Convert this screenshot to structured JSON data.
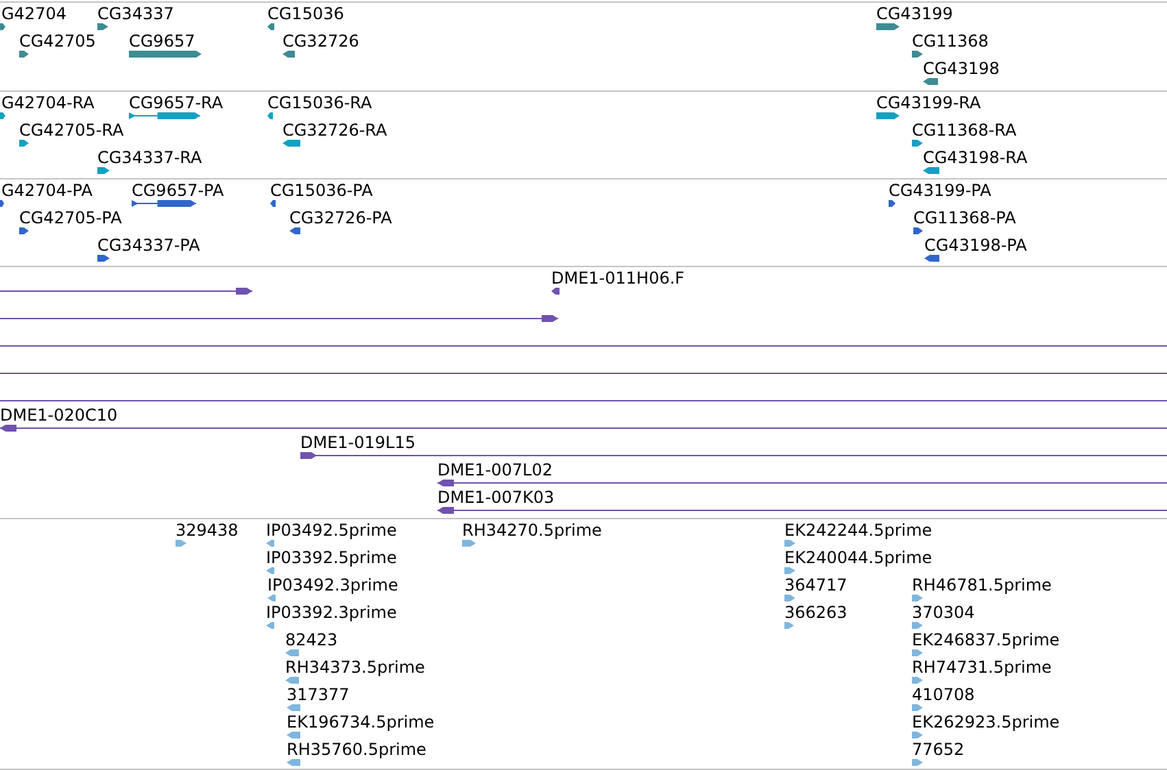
{
  "tracks": [
    {
      "kind": "gene",
      "color": "#3d8c94",
      "features": [
        {
          "label": "G42704",
          "reverse": false
        },
        {
          "label": "CG34337",
          "reverse": false
        },
        {
          "label": "CG15036",
          "reverse": true
        },
        {
          "label": "CG43199",
          "reverse": false
        },
        {
          "label": "CG42705",
          "reverse": false
        },
        {
          "label": "CG9657",
          "reverse": false
        },
        {
          "label": "CG32726",
          "reverse": true
        },
        {
          "label": "CG11368",
          "reverse": false
        },
        {
          "label": "CG43198",
          "reverse": true
        }
      ]
    },
    {
      "kind": "transcript",
      "color": "#13a1c1",
      "features": [
        {
          "label": "G42704-RA",
          "reverse": false
        },
        {
          "label": "CG9657-RA",
          "reverse": false
        },
        {
          "label": "CG15036-RA",
          "reverse": true
        },
        {
          "label": "CG43199-RA",
          "reverse": false
        },
        {
          "label": "CG42705-RA",
          "reverse": false
        },
        {
          "label": "CG32726-RA",
          "reverse": true
        },
        {
          "label": "CG11368-RA",
          "reverse": false
        },
        {
          "label": "CG34337-RA",
          "reverse": false
        },
        {
          "label": "CG43198-RA",
          "reverse": true
        }
      ]
    },
    {
      "kind": "transcript",
      "color": "#3166cc",
      "features": [
        {
          "label": "G42704-PA",
          "reverse": false
        },
        {
          "label": "CG9657-PA",
          "reverse": false
        },
        {
          "label": "CG15036-PA",
          "reverse": true
        },
        {
          "label": "CG43199-PA",
          "reverse": false
        },
        {
          "label": "CG42705-PA",
          "reverse": false
        },
        {
          "label": "CG32726-PA",
          "reverse": true
        },
        {
          "label": "CG11368-PA",
          "reverse": false
        },
        {
          "label": "CG34337-PA",
          "reverse": false
        },
        {
          "label": "CG43198-PA",
          "reverse": true
        }
      ]
    },
    {
      "kind": "clone",
      "color": "#7052ae",
      "features": [
        {
          "kind": "line",
          "reverse": false
        },
        {
          "kind": "arrow",
          "label": "DME1-011H06.F",
          "reverse": true
        },
        {
          "kind": "line",
          "reverse": false
        },
        {
          "kind": "line"
        },
        {
          "kind": "line"
        },
        {
          "kind": "line"
        },
        {
          "kind": "line",
          "label": "DME1-020C10",
          "reverse": true
        },
        {
          "kind": "line",
          "label": "DME1-019L15",
          "reverse": false
        },
        {
          "kind": "line",
          "label": "DME1-007L02",
          "reverse": true
        },
        {
          "kind": "line",
          "label": "DME1-007K03",
          "reverse": true
        }
      ]
    },
    {
      "kind": "est",
      "color": "#7fb6de",
      "features": [
        {
          "label": "329438",
          "reverse": false
        },
        {
          "label": "IP03492.5prime",
          "reverse": true
        },
        {
          "label": "RH34270.5prime",
          "reverse": false
        },
        {
          "label": "EK242244.5prime",
          "reverse": false
        },
        {
          "label": "IP03392.5prime",
          "reverse": true
        },
        {
          "label": "EK240044.5prime",
          "reverse": false
        },
        {
          "label": "IP03492.3prime",
          "reverse": true
        },
        {
          "label": "364717",
          "reverse": false
        },
        {
          "label": "RH46781.5prime",
          "reverse": false
        },
        {
          "label": "IP03392.3prime",
          "reverse": true
        },
        {
          "label": "366263",
          "reverse": false
        },
        {
          "label": "370304",
          "reverse": false
        },
        {
          "label": "82423",
          "reverse": true
        },
        {
          "label": "EK246837.5prime",
          "reverse": false
        },
        {
          "label": "RH34373.5prime",
          "reverse": true
        },
        {
          "label": "RH74731.5prime",
          "reverse": false
        },
        {
          "label": "317377",
          "reverse": true
        },
        {
          "label": "410708",
          "reverse": false
        },
        {
          "label": "EK196734.5prime",
          "reverse": true
        },
        {
          "label": "EK262923.5prime",
          "reverse": false
        },
        {
          "label": "RH35760.5prime",
          "reverse": true
        },
        {
          "label": "77652",
          "reverse": false
        }
      ]
    }
  ]
}
